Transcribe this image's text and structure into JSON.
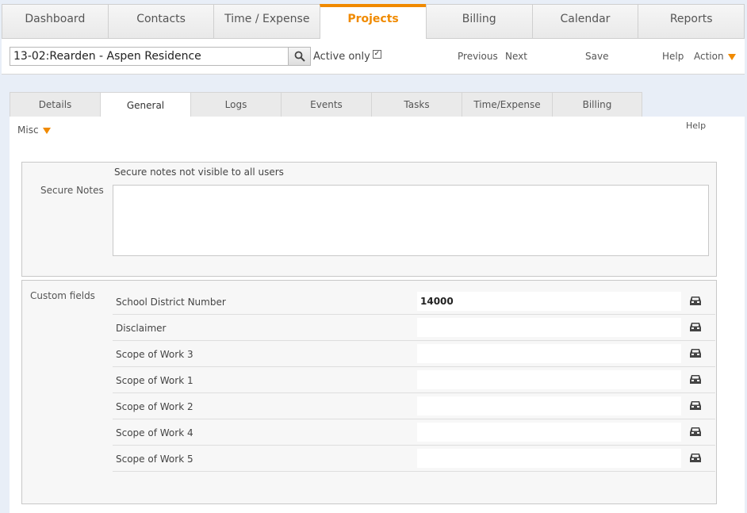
{
  "nav": {
    "tabs": [
      "Dashboard",
      "Contacts",
      "Time / Expense",
      "Projects",
      "Billing",
      "Calendar",
      "Reports"
    ],
    "active": "Projects"
  },
  "toolbar": {
    "project_value": "13-02:Rearden - Aspen Residence",
    "active_only_label": "Active only",
    "active_only_checked": true,
    "previous": "Previous",
    "next": "Next",
    "save": "Save",
    "help": "Help",
    "action": "Action"
  },
  "subtabs": {
    "items": [
      "Details",
      "General",
      "Logs",
      "Events",
      "Tasks",
      "Time/Expense",
      "Billing"
    ],
    "active": "General"
  },
  "panel": {
    "misc_label": "Misc",
    "help_label": "Help",
    "secure_notes": {
      "label": "Secure Notes",
      "hint": "Secure notes not visible to all users",
      "value": ""
    },
    "custom_fields": {
      "label": "Custom fields",
      "rows": [
        {
          "label": "School District Number",
          "value": "14000"
        },
        {
          "label": "Disclaimer",
          "value": ""
        },
        {
          "label": "Scope of Work 3",
          "value": ""
        },
        {
          "label": "Scope of Work 1",
          "value": ""
        },
        {
          "label": "Scope of Work 2",
          "value": ""
        },
        {
          "label": "Scope of Work 4",
          "value": ""
        },
        {
          "label": "Scope of Work 5",
          "value": ""
        }
      ]
    }
  },
  "colors": {
    "accent": "#f08a00",
    "background": "#e8eef7"
  },
  "icons": {
    "search": "magnifier-icon",
    "dropdown": "orange-triangle-down-icon",
    "row_action": "inbox-tray-icon"
  }
}
